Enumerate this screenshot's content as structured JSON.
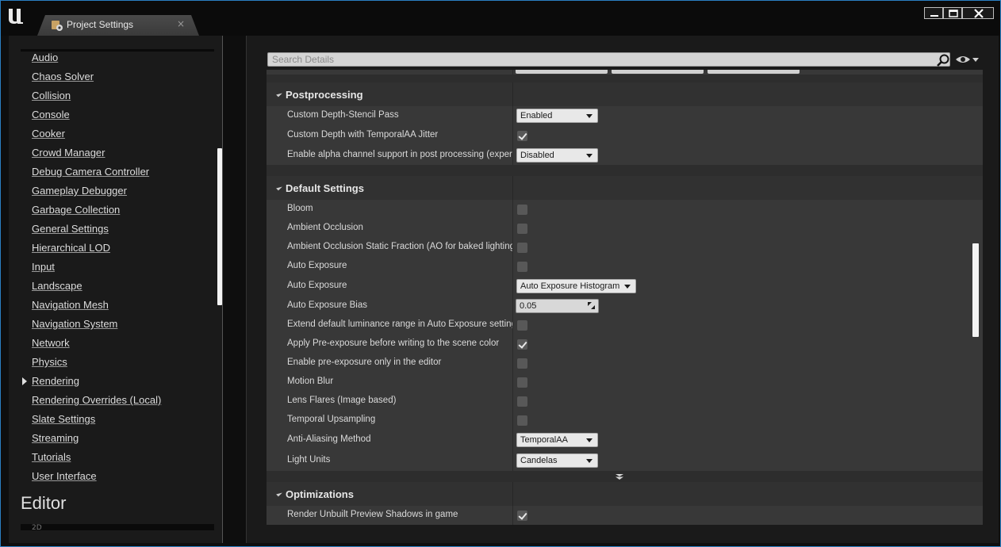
{
  "window": {
    "tab_title": "Project Settings",
    "tab_close": "×",
    "colors": {
      "accent": "#2a7fc2",
      "panel": "#383838",
      "category": "#313131"
    }
  },
  "sidebar": {
    "items": [
      "Audio",
      "Chaos Solver",
      "Collision",
      "Console",
      "Cooker",
      "Crowd Manager",
      "Debug Camera Controller",
      "Gameplay Debugger",
      "Garbage Collection",
      "General Settings",
      "Hierarchical LOD",
      "Input",
      "Landscape",
      "Navigation Mesh",
      "Navigation System",
      "Network",
      "Physics",
      "Rendering",
      "Rendering Overrides (Local)",
      "Slate Settings",
      "Streaming",
      "Tutorials",
      "User Interface"
    ],
    "selected": "Rendering",
    "section_heading": "Editor",
    "peek_text": "2D"
  },
  "search": {
    "placeholder": "Search Details"
  },
  "categories": {
    "postprocessing": {
      "title": "Postprocessing",
      "rows": [
        {
          "label": "Custom Depth-Stencil Pass",
          "type": "combo",
          "value": "Enabled"
        },
        {
          "label": "Custom Depth with TemporalAA Jitter",
          "type": "check",
          "checked": true
        },
        {
          "label": "Enable alpha channel support in post processing (experimental)",
          "type": "combo",
          "value": "Disabled"
        }
      ]
    },
    "default_settings": {
      "title": "Default Settings",
      "rows": [
        {
          "label": "Bloom",
          "type": "check",
          "checked": false
        },
        {
          "label": "Ambient Occlusion",
          "type": "check",
          "checked": false
        },
        {
          "label": "Ambient Occlusion Static Fraction (AO for baked lighting)",
          "type": "check",
          "checked": false
        },
        {
          "label": "Auto Exposure",
          "type": "check",
          "checked": false
        },
        {
          "label": "Auto Exposure",
          "type": "combo",
          "value": "Auto Exposure Histogram"
        },
        {
          "label": "Auto Exposure Bias",
          "type": "number",
          "value": "0.05"
        },
        {
          "label": "Extend default luminance range in Auto Exposure settings",
          "type": "check",
          "checked": false
        },
        {
          "label": "Apply Pre-exposure before writing to the scene color",
          "type": "check",
          "checked": true
        },
        {
          "label": "Enable pre-exposure only in the editor",
          "type": "check",
          "checked": false
        },
        {
          "label": "Motion Blur",
          "type": "check",
          "checked": false
        },
        {
          "label": "Lens Flares (Image based)",
          "type": "check",
          "checked": false
        },
        {
          "label": "Temporal Upsampling",
          "type": "check",
          "checked": false
        },
        {
          "label": "Anti-Aliasing Method",
          "type": "combo",
          "value": "TemporalAA"
        },
        {
          "label": "Light Units",
          "type": "combo",
          "value": "Candelas"
        }
      ]
    },
    "optimizations": {
      "title": "Optimizations",
      "rows": [
        {
          "label": "Render Unbuilt Preview Shadows in game",
          "type": "check",
          "checked": true
        }
      ]
    }
  }
}
